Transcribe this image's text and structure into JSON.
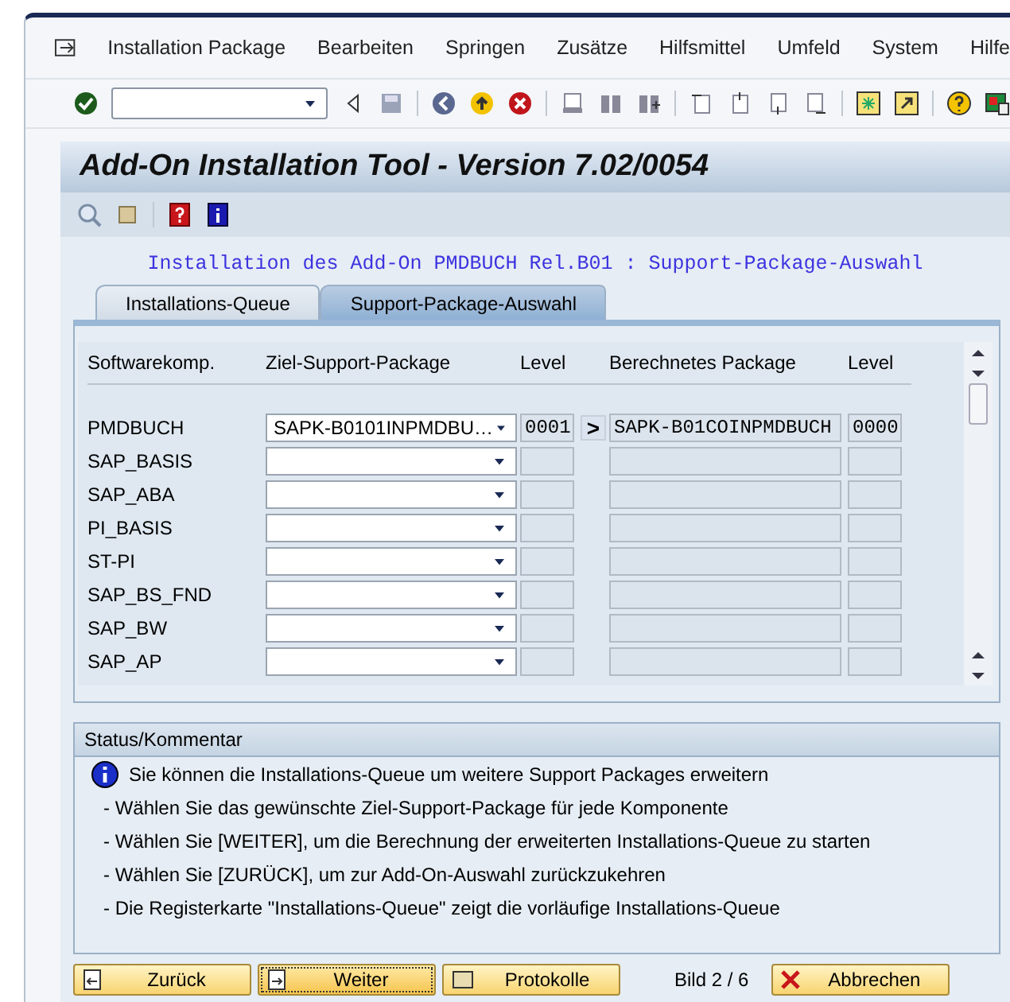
{
  "menu": [
    "Installation Package",
    "Bearbeiten",
    "Springen",
    "Zusätze",
    "Hilfsmittel",
    "Umfeld",
    "System",
    "Hilfe"
  ],
  "title": "Add-On Installation Tool - Version 7.02/0054",
  "heading": "Installation des Add-On PMDBUCH Rel.B01 : Support-Package-Auswahl",
  "tabs": [
    {
      "label": "Installations-Queue",
      "selected": false
    },
    {
      "label": "Support-Package-Auswahl",
      "selected": true
    }
  ],
  "table": {
    "columns": [
      "Softwarekomp.",
      "Ziel-Support-Package",
      "Level",
      "Berechnetes Package",
      "Level"
    ],
    "rows": [
      {
        "component": "PMDBUCH",
        "target": "SAPK-B0101INPMDBU…",
        "level": "0001",
        "arrow": ">",
        "calculated": "SAPK-B01COINPMDBUCH",
        "calc_level": "0000"
      },
      {
        "component": "SAP_BASIS"
      },
      {
        "component": "SAP_ABA"
      },
      {
        "component": "PI_BASIS"
      },
      {
        "component": "ST-PI"
      },
      {
        "component": "SAP_BS_FND"
      },
      {
        "component": "SAP_BW"
      },
      {
        "component": "SAP_AP"
      }
    ]
  },
  "status": {
    "title": "Status/Kommentar",
    "lines": [
      {
        "kind": "info",
        "text": "Sie können die Installations-Queue um weitere Support Packages erweitern"
      },
      {
        "kind": "plain",
        "text": "- Wählen Sie das gewünschte Ziel-Support-Package für jede Komponente"
      },
      {
        "kind": "plain",
        "text": "- Wählen Sie [WEITER], um die Berechnung der erweiterten Installations-Queue zu starten"
      },
      {
        "kind": "plain",
        "text": "- Wählen Sie [ZURÜCK], um zur Add-On-Auswahl zurückzukehren"
      },
      {
        "kind": "plain",
        "text": "- Die Registerkarte \"Installations-Queue\" zeigt die vorläufige Installations-Queue"
      }
    ]
  },
  "buttons": [
    {
      "kind": "back",
      "label": "Zurück",
      "focused": false
    },
    {
      "kind": "next",
      "label": "Weiter",
      "focused": true
    },
    {
      "kind": "log",
      "label": "Protokolle",
      "focused": false
    }
  ],
  "page_indicator": "Bild 2 / 6",
  "cancel": {
    "label": "Abbrechen"
  }
}
